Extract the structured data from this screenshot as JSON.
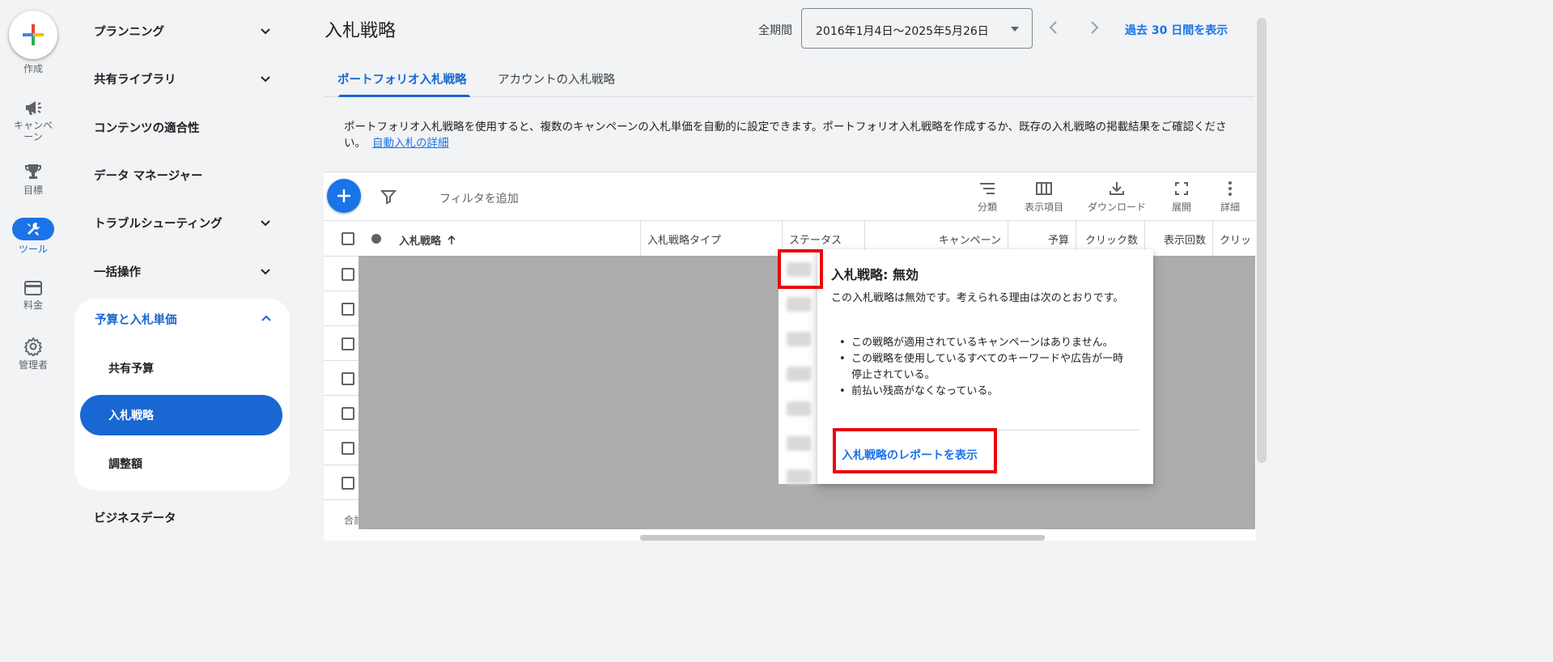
{
  "rail": {
    "create_label": "作成",
    "items": [
      {
        "label": "キャンペーン",
        "icon": "megaphone-icon"
      },
      {
        "label": "目標",
        "icon": "trophy-icon"
      },
      {
        "label": "ツール",
        "icon": "tools-icon"
      },
      {
        "label": "料金",
        "icon": "credit-card-icon"
      },
      {
        "label": "管理者",
        "icon": "gear-icon"
      }
    ]
  },
  "menu": {
    "items": [
      "プランニング",
      "共有ライブラリ",
      "コンテンツの適合性",
      "データ マネージャー",
      "トラブルシューティング",
      "一括操作"
    ],
    "expanded_section": "予算と入札単価",
    "sub_items": [
      "共有予算",
      "入札戦略",
      "調整額"
    ],
    "bottom_item": "ビジネスデータ"
  },
  "header": {
    "title": "入札戦略",
    "period_label": "全期間",
    "date_range": "2016年1月4日～2025年5月26日",
    "last30_link": "過去 30 日間を表示"
  },
  "tabs": [
    "ポートフォリオ入札戦略",
    "アカウントの入札戦略"
  ],
  "description": {
    "text": "ポートフォリオ入札戦略を使用すると、複数のキャンペーンの入札単価を自動的に設定できます。ポートフォリオ入札戦略を作成するか、既存の入札戦略の掲載結果をご確認ください。",
    "link": "自動入札の詳細"
  },
  "toolbar": {
    "filter_placeholder": "フィルタを追加",
    "tools": [
      "分類",
      "表示項目",
      "ダウンロード",
      "展開",
      "詳細"
    ]
  },
  "table": {
    "columns": [
      "入札戦略",
      "入札戦略タイプ",
      "ステータス",
      "キャンペーン",
      "予算",
      "クリック数",
      "表示回数",
      "クリッ"
    ],
    "total_label": "合計"
  },
  "popover": {
    "title": "入札戦略: 無効",
    "body": "この入札戦略は無効です。考えられる理由は次のとおりです。",
    "reasons": [
      "この戦略が適用されているキャンペーンはありません。",
      "この戦略を使用しているすべてのキーワードや広告が一時停止されている。",
      "前払い残高がなくなっている。"
    ],
    "link": "入札戦略のレポートを表示"
  },
  "colors": {
    "accent": "#1a73e8",
    "highlight": "#e8080d",
    "redaction": "#acacac"
  }
}
